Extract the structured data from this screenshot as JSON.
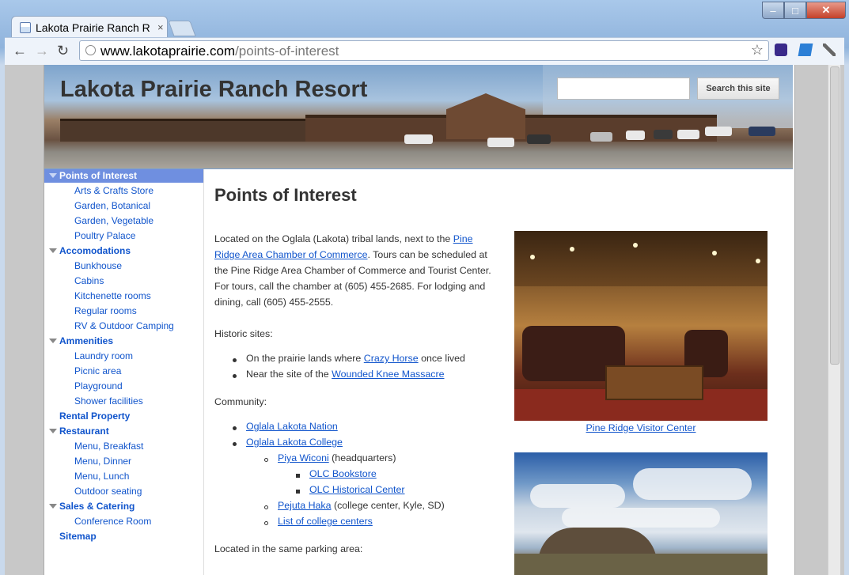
{
  "browser": {
    "tab_title": "Lakota Prairie Ranch R",
    "tab_close": "×",
    "url_domain": "www.lakotaprairie.com",
    "url_path": "/points-of-interest",
    "back": "←",
    "forward": "→",
    "reload": "↻",
    "star": "☆",
    "min": "–",
    "max": "□",
    "close": "✕"
  },
  "site": {
    "title": "Lakota Prairie Ranch Resort",
    "search_button": "Search this site"
  },
  "sidebar": {
    "items": [
      {
        "label": "Points of Interest",
        "level": 0
      },
      {
        "label": "Arts & Crafts Store",
        "level": 1
      },
      {
        "label": "Garden, Botanical",
        "level": 1
      },
      {
        "label": "Garden, Vegetable",
        "level": 1
      },
      {
        "label": "Poultry Palace",
        "level": 1
      },
      {
        "label": "Accomodations",
        "level": 0
      },
      {
        "label": "Bunkhouse",
        "level": 1
      },
      {
        "label": "Cabins",
        "level": 1
      },
      {
        "label": "Kitchenette rooms",
        "level": 1
      },
      {
        "label": "Regular rooms",
        "level": 1
      },
      {
        "label": "RV & Outdoor Camping",
        "level": 1
      },
      {
        "label": "Ammenities",
        "level": 0
      },
      {
        "label": "Laundry room",
        "level": 1
      },
      {
        "label": "Picnic area",
        "level": 1
      },
      {
        "label": "Playground",
        "level": 1
      },
      {
        "label": "Shower facilities",
        "level": 1
      },
      {
        "label": "Rental Property",
        "level": 0
      },
      {
        "label": "Restaurant",
        "level": 0
      },
      {
        "label": "Menu, Breakfast",
        "level": 1
      },
      {
        "label": "Menu, Dinner",
        "level": 1
      },
      {
        "label": "Menu, Lunch",
        "level": 1
      },
      {
        "label": "Outdoor seating",
        "level": 1
      },
      {
        "label": "Sales & Catering",
        "level": 0
      },
      {
        "label": "Conference Room",
        "level": 1
      },
      {
        "label": "Sitemap",
        "level": 0
      }
    ]
  },
  "main": {
    "heading": "Points of Interest",
    "intro_1": "Located on the Oglala (Lakota) tribal lands, next to the ",
    "intro_link": "Pine Ridge Area Chamber of Commerce",
    "intro_2": ". Tours can be scheduled at the Pine Ridge Area Chamber of Commerce and Tourist Center. For tours, call the chamber at (605) 455-2685. For lodging and dining, call (605) 455-2555.",
    "historic_heading": "Historic sites:",
    "historic_1_pre": "On the prairie lands where ",
    "historic_1_link": "Crazy Horse",
    "historic_1_post": " once lived",
    "historic_2_pre": "Near the site of the ",
    "historic_2_link": "Wounded Knee Massacre",
    "community_heading": "Community:",
    "community_1": "Oglala Lakota Nation",
    "community_2": "Oglala Lakota College",
    "piya_link": "Piya Wiconi",
    "piya_post": " (headquarters)",
    "olc_bookstore": "OLC Bookstore",
    "olc_historical": "OLC Historical Center",
    "pejuta_link": "Pejuta Haka",
    "pejuta_post": " (college center, Kyle, SD)",
    "college_centers": "List of college centers",
    "parking_heading": "Located in the same parking area:",
    "photo1_caption": "Pine Ridge Visitor Center"
  },
  "colors": {
    "link": "#1155cc",
    "nav_active_bg": "#6f8fe0"
  }
}
